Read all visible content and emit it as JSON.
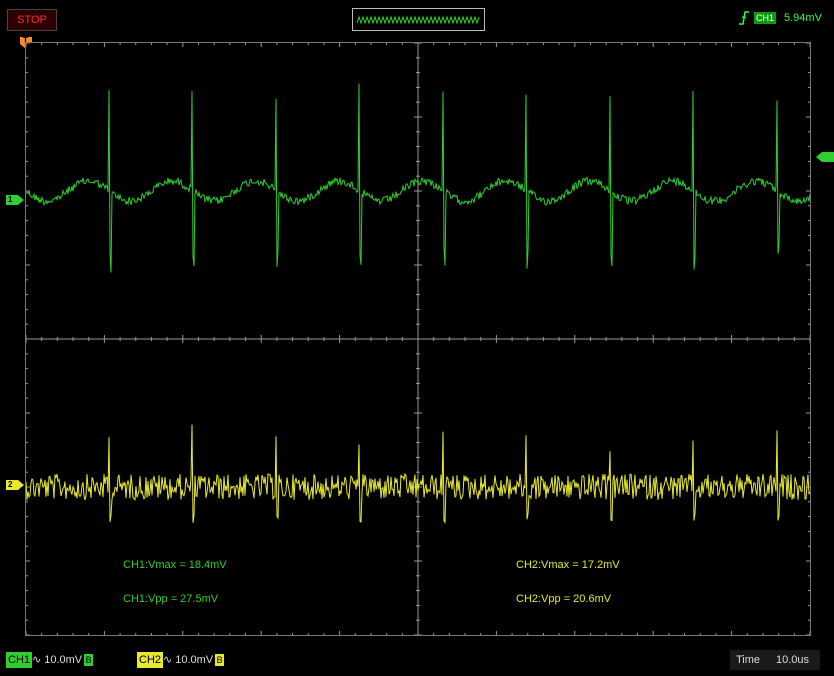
{
  "status": {
    "run_state": "STOP"
  },
  "trigger": {
    "channel": "CH1",
    "level": "5.94mV",
    "edge": "rising-edge-icon"
  },
  "markers": {
    "ch1": "1",
    "ch2": "2",
    "trigger_position": "T"
  },
  "measurements": {
    "ch1_vmax": "CH1:Vmax = 18.4mV",
    "ch1_vpp": "CH1:Vpp = 27.5mV",
    "ch2_vmax": "CH2:Vmax = 17.2mV",
    "ch2_vpp": "CH2:Vpp = 20.6mV"
  },
  "channels": [
    {
      "tag": "CH1",
      "coupling": "∿",
      "scale": "10.0mV",
      "bw": "B",
      "color": "#2ecf2e"
    },
    {
      "tag": "CH2",
      "coupling": "∿",
      "scale": "10.0mV",
      "bw": "B",
      "color": "#e8e82e"
    }
  ],
  "timebase": {
    "label": "Time",
    "value": "10.0us"
  },
  "colors": {
    "ch1": "#2ecf2e",
    "ch2": "#e8e82e",
    "grid": "#9a9a9a",
    "stop": "#ff2a2a"
  }
}
